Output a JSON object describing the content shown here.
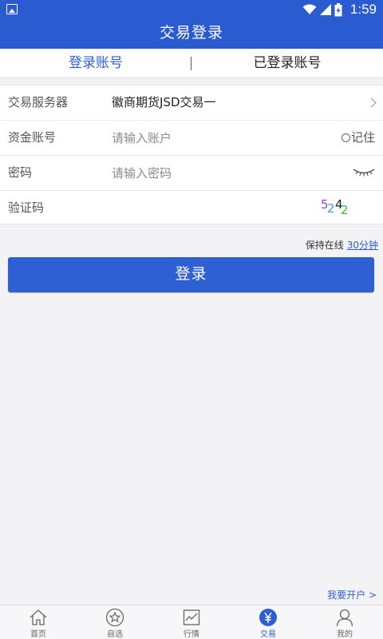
{
  "status_bar": {
    "time": "1:59"
  },
  "header": {
    "title": "交易登录"
  },
  "tabs": [
    {
      "label": "登录账号",
      "active": true
    },
    {
      "label": "已登录账号",
      "active": false
    }
  ],
  "form": {
    "server": {
      "label": "交易服务器",
      "value": "徽商期货JSD交易一"
    },
    "account": {
      "label": "资金账号",
      "placeholder": "请输入账户",
      "value": "",
      "remember_label": "记住"
    },
    "password": {
      "label": "密码",
      "placeholder": "请输入密码",
      "value": ""
    },
    "captcha": {
      "label": "验证码",
      "value": "",
      "code_digits": [
        "5",
        "2",
        "4",
        "2"
      ],
      "code_colors": [
        "#9b3fd6",
        "#2ea6d8",
        "#222222",
        "#2bc43a"
      ]
    }
  },
  "session": {
    "keep_online_label": "保持在线",
    "keep_online_value": "30分钟"
  },
  "login_button": {
    "label": "登录"
  },
  "open_account_link": "我要开户 >",
  "bottom_nav": [
    {
      "label": "首页",
      "icon": "home-icon",
      "active": false
    },
    {
      "label": "自选",
      "icon": "star-icon",
      "active": false
    },
    {
      "label": "行情",
      "icon": "chart-icon",
      "active": false
    },
    {
      "label": "交易",
      "icon": "yen-icon",
      "active": true
    },
    {
      "label": "我的",
      "icon": "user-icon",
      "active": false
    }
  ],
  "colors": {
    "brand": "#2a5bd0",
    "link": "#2d5fd3"
  }
}
